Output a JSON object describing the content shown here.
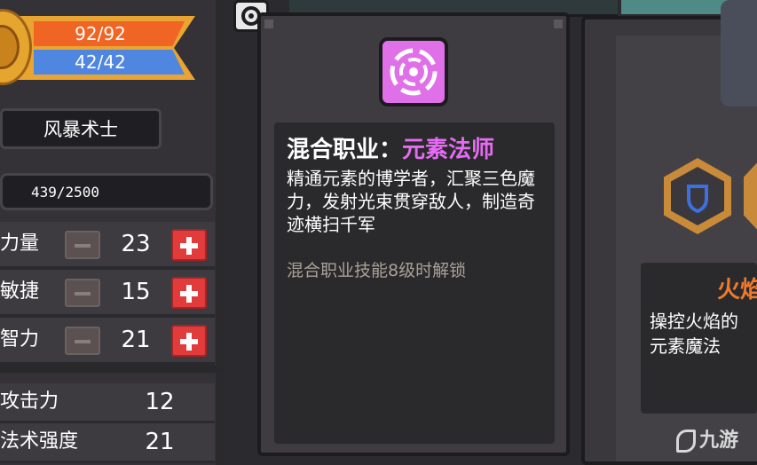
{
  "player": {
    "hp": "92/92",
    "mp": "42/42",
    "class_name": "风暴术士",
    "exp": "439/2500"
  },
  "stats": [
    {
      "label": "力量",
      "value": "23"
    },
    {
      "label": "敏捷",
      "value": "15"
    },
    {
      "label": "智力",
      "value": "21"
    }
  ],
  "derived": [
    {
      "label": "攻击力",
      "value": "12"
    },
    {
      "label": "法术强度",
      "value": "21"
    }
  ],
  "tooltip": {
    "title_prefix": "混合职业：",
    "class_name": "元素法师",
    "description": "精通元素的博学者，汇聚三色魔力，发射光束贯穿敌人，制造奇迹横扫千军",
    "unlock_hint": "混合职业技能8级时解锁",
    "icon": "vortex-icon"
  },
  "right_card": {
    "title": "火焰",
    "description": "操控火焰的\n元素魔法"
  },
  "watermark": "九游",
  "colors": {
    "hp": "#f06424",
    "mp": "#4f86e0",
    "class_accent": "#e56cf2",
    "right_title": "#f07a2a",
    "plus": "#e13b3b"
  }
}
